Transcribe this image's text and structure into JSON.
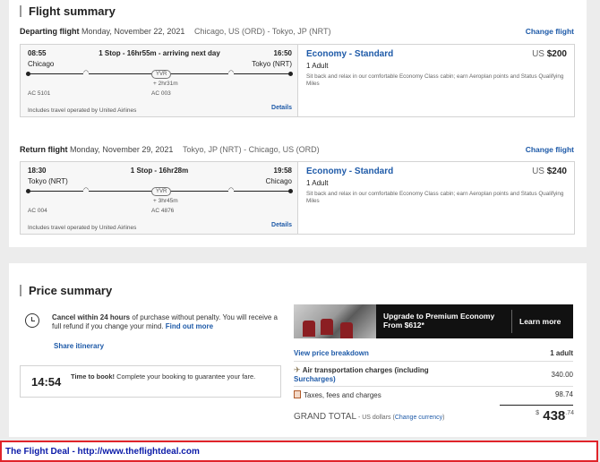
{
  "flight_summary": {
    "title": "Flight summary",
    "departing": {
      "label": "Departing flight",
      "date": "Monday, November 22, 2021",
      "route": "Chicago, US (ORD) - Tokyo, JP (NRT)",
      "change": "Change flight",
      "dep_time": "08:55",
      "arr_time": "16:50",
      "stops": "1 Stop - 16hr55m - arriving next day",
      "origin": "Chicago",
      "destination": "Tokyo (NRT)",
      "hub": "YVR",
      "layover": "+ 2hr31m",
      "flight1": "AC 5101",
      "flight2": "AC 003",
      "operated": "Includes travel operated by United Airlines",
      "details": "Details",
      "cabin": "Economy - Standard",
      "currency": "US",
      "price": "$200",
      "pax": "1 Adult",
      "desc": "Sit back and relax in our comfortable Economy Class cabin; earn Aeroplan points and Status Qualifying Miles"
    },
    "return": {
      "label": "Return flight",
      "date": "Monday, November 29, 2021",
      "route": "Tokyo, JP (NRT) - Chicago, US (ORD)",
      "change": "Change flight",
      "dep_time": "18:30",
      "arr_time": "19:58",
      "stops": "1 Stop - 16hr28m",
      "origin": "Tokyo (NRT)",
      "destination": "Chicago",
      "hub": "YVR",
      "layover": "+ 3hr45m",
      "flight1": "AC 004",
      "flight2": "AC 4876",
      "operated": "Includes travel operated by United Airlines",
      "details": "Details",
      "cabin": "Economy - Standard",
      "currency": "US",
      "price": "$240",
      "pax": "1 Adult",
      "desc": "Sit back and relax in our comfortable Economy Class cabin; earn Aeroplan points and Status Qualifying Miles"
    }
  },
  "price_summary": {
    "title": "Price summary",
    "cancel_bold": "Cancel within 24 hours",
    "cancel_text": " of purchase without penalty. You will receive a full refund if you change your mind. ",
    "find_out": "Find out more",
    "share": "Share itinerary",
    "timer": "14:54",
    "time_bold": "Time to book!",
    "time_text": " Complete your booking to guarantee your fare.",
    "banner_line1": "Upgrade to Premium Economy",
    "banner_line2": "From $612*",
    "learn_more": "Learn more",
    "breakdown": "View price breakdown",
    "pax": "1 adult",
    "air_label": "Air transportation charges (including",
    "air_label2": "Surcharges)",
    "air_value": "340.00",
    "tax_label": "Taxes, fees and charges",
    "tax_value": "98.74",
    "grand_label": "GRAND TOTAL",
    "grand_sub": " - US dollars (",
    "change_currency": "Change currency",
    "grand_close": ")",
    "grand_symbol": "$",
    "grand_int": "438",
    "grand_cents": ".74"
  },
  "footer": {
    "text": "The Flight Deal - http://www.theflightdeal.com"
  },
  "colors": {
    "link": "#1e5aa8",
    "footer_border": "#e0242a",
    "footer_text": "#0a1aa8"
  }
}
